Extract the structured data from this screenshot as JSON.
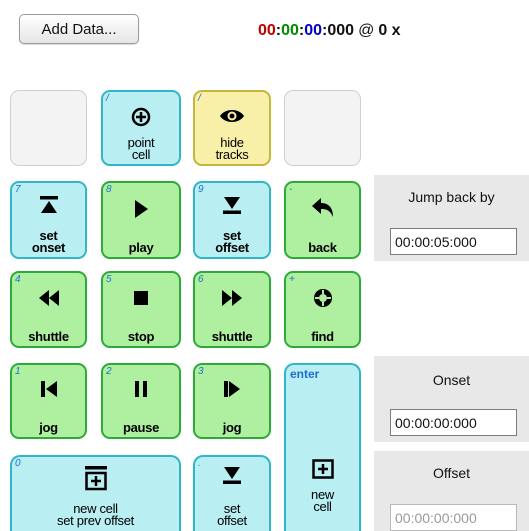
{
  "toolbar": {
    "add_data_label": "Add Data..."
  },
  "clock": {
    "hours": "00",
    "minutes": "00",
    "seconds": "00",
    "millis": "000",
    "sep": ":",
    "at": "@",
    "rate": "0 x",
    "colors": {
      "hours": "#c00000",
      "minutes": "#008a00",
      "seconds": "#0000c0"
    }
  },
  "keypad": {
    "row1": [
      {
        "num": "",
        "label": ""
      },
      {
        "num": "/",
        "label1": "point",
        "label2": "cell",
        "icon": "circle-plus-icon"
      },
      {
        "num": "/",
        "label1": "hide",
        "label2": "tracks",
        "icon": "eye-icon"
      },
      {
        "num": "",
        "label": ""
      }
    ],
    "row2": [
      {
        "num": "7",
        "label1": "set",
        "label2": "onset",
        "icon": "set-onset-icon"
      },
      {
        "num": "8",
        "label": "play",
        "icon": "play-icon"
      },
      {
        "num": "9",
        "label1": "set",
        "label2": "offset",
        "icon": "set-offset-icon"
      },
      {
        "num": "-",
        "label": "back",
        "icon": "back-arrow-icon"
      }
    ],
    "row3": [
      {
        "num": "4",
        "label": "shuttle",
        "icon": "rewind-icon"
      },
      {
        "num": "5",
        "label": "stop",
        "icon": "stop-icon"
      },
      {
        "num": "6",
        "label": "shuttle",
        "icon": "fast-forward-icon"
      },
      {
        "num": "+",
        "label": "find",
        "icon": "find-icon"
      }
    ],
    "row4": [
      {
        "num": "1",
        "label": "jog",
        "icon": "jog-back-icon"
      },
      {
        "num": "2",
        "label": "pause",
        "icon": "pause-icon"
      },
      {
        "num": "3",
        "label": "jog",
        "icon": "jog-forward-icon"
      }
    ],
    "enter": {
      "num": "enter",
      "label1": "new",
      "label2": "cell",
      "icon": "new-cell-icon"
    },
    "row5": [
      {
        "num": "0",
        "label1": "new cell",
        "label2": "set prev offset",
        "icon": "new-cell-prev-icon"
      },
      {
        "num": ".",
        "label1": "set",
        "label2": "offset",
        "icon": "set-offset-icon"
      }
    ]
  },
  "side": {
    "jump_back_label": "Jump back by",
    "jump_back_value": "00:00:05:000",
    "onset_label": "Onset",
    "onset_value": "00:00:00:000",
    "offset_label": "Offset",
    "offset_value": "00:00:00:000"
  }
}
